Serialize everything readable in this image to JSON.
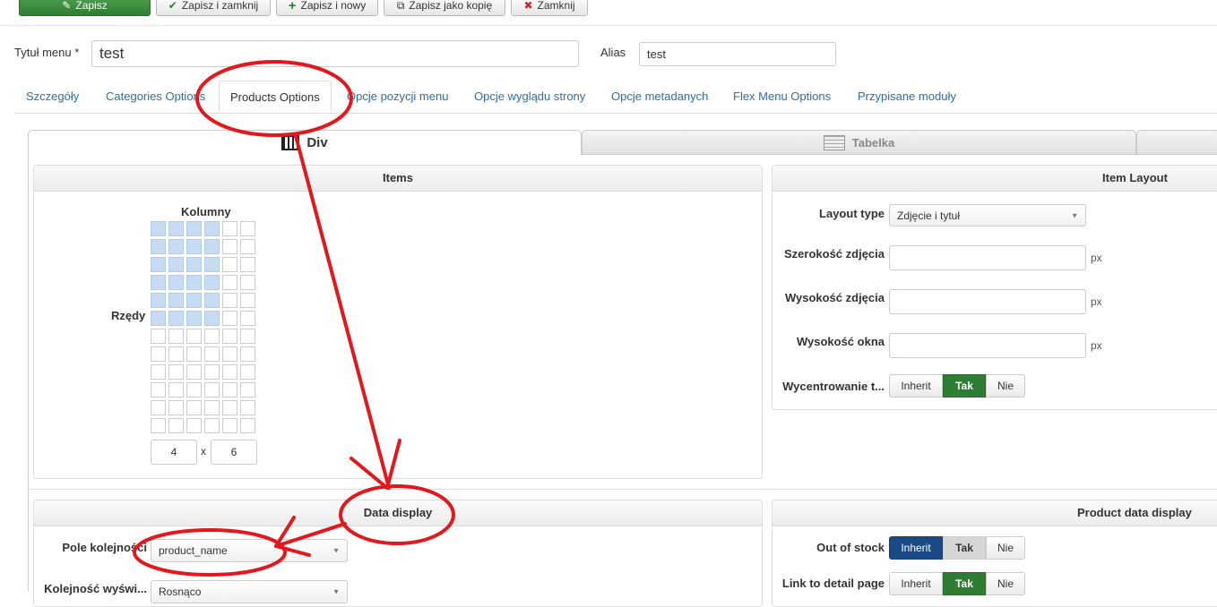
{
  "toolbar": {
    "save": "Zapisz",
    "save_close": "Zapisz i zamknij",
    "save_new": "Zapisz i nowy",
    "save_copy": "Zapisz jako kopię",
    "close": "Zamknij"
  },
  "form": {
    "title_label": "Tytuł menu *",
    "title_value": "test",
    "alias_label": "Alias",
    "alias_value": "test"
  },
  "tabs": [
    {
      "label": "Szczegóły"
    },
    {
      "label": "Categories Options"
    },
    {
      "label": "Products Options",
      "active": true
    },
    {
      "label": "Opcje pozycji menu"
    },
    {
      "label": "Opcje wyglądu strony"
    },
    {
      "label": "Opcje metadanych"
    },
    {
      "label": "Flex Menu Options"
    },
    {
      "label": "Przypisane moduły"
    }
  ],
  "subtabs": {
    "div": "Div",
    "table": "Tabelka"
  },
  "items_panel": {
    "title": "Items",
    "columns_label": "Kolumny",
    "rows_label": "Rzędy",
    "columns_value": "4",
    "x_label": "x",
    "rows_value": "6",
    "selected_columns": 4,
    "selected_rows": 6,
    "grid_columns": 6,
    "grid_rows": 12
  },
  "item_layout": {
    "title": "Item Layout",
    "layout_type_label": "Layout type",
    "layout_type_value": "Zdjęcie i tytuł",
    "image_width_label": "Szerokość zdjęcia",
    "image_height_label": "Wysokość zdjęcia",
    "window_height_label": "Wysokość okna",
    "unit": "px",
    "center_label": "Wycentrowanie t...",
    "center_options": [
      "Inherit",
      "Tak",
      "Nie"
    ],
    "center_selected": "Tak"
  },
  "data_display": {
    "title": "Data display",
    "order_field_label": "Pole kolejności",
    "order_field_value": "product_name",
    "order_dir_label": "Kolejność wyświ...",
    "order_dir_value": "Rosnąco"
  },
  "product_data_display": {
    "title": "Product data display",
    "out_of_stock_label": "Out of stock",
    "out_of_stock_options": [
      "Inherit",
      "Tak",
      "Nie"
    ],
    "out_of_stock_selected": "Inherit",
    "link_label": "Link to detail page",
    "link_options": [
      "Inherit",
      "Tak",
      "Nie"
    ],
    "link_selected": "Tak"
  },
  "colors": {
    "annotation": "#e3171c",
    "green": "#2f7d32",
    "blue": "#1a4a86",
    "link": "#2a6fb0",
    "grid_selected": "#c7dcf3"
  }
}
